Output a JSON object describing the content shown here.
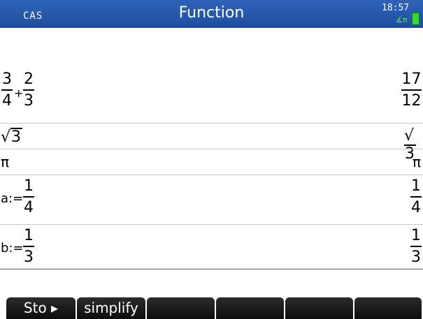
{
  "title_bar": {
    "mode": "CAS",
    "title": "Function",
    "time": "18:57",
    "angle_indicator": "∡π"
  },
  "history": [
    {
      "input": {
        "num": "3",
        "op": "+",
        "num2": "2",
        "den": "4",
        "den2": "3"
      },
      "output": {
        "num": "17",
        "den": "12"
      }
    },
    {
      "input": {
        "radicand": "3"
      },
      "output": {
        "radicand": "3"
      }
    },
    {
      "input": {
        "text": "π"
      },
      "output": {
        "text": "π"
      }
    },
    {
      "input": {
        "prefix": "a:=",
        "num": "1",
        "den": "4"
      },
      "output": {
        "num": "1",
        "den": "4"
      }
    },
    {
      "input": {
        "prefix": "b:=",
        "num": "1",
        "den": "3"
      },
      "output": {
        "num": "1",
        "den": "3"
      }
    }
  ],
  "soft_menu": [
    "Sto ▸",
    "simplify",
    "",
    "",
    "",
    ""
  ]
}
